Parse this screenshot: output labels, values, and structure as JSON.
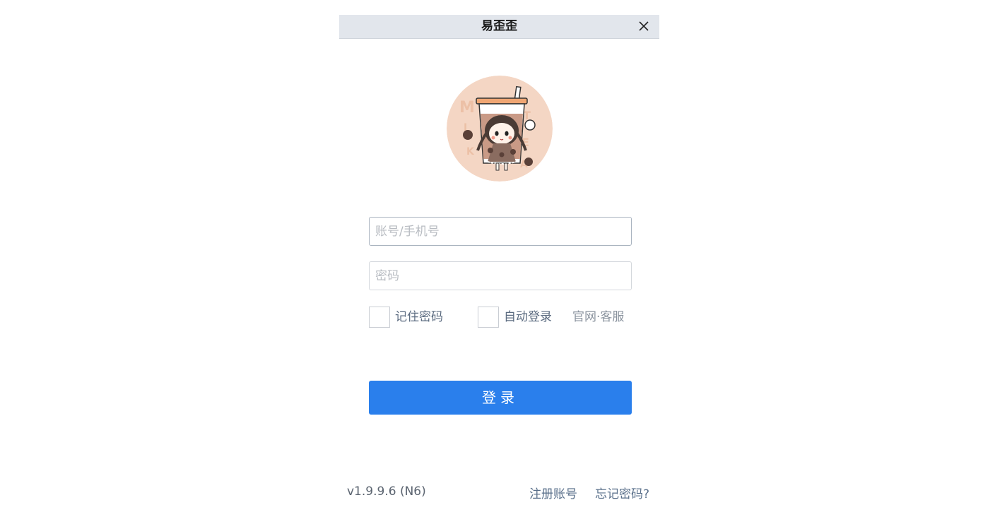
{
  "window": {
    "title": "易歪歪"
  },
  "avatar": {
    "name": "milk-tea-girl-avatar",
    "lettering": "MILK TEA",
    "background_color": "#f4d6c4"
  },
  "login_form": {
    "account_placeholder": "账号/手机号",
    "account_value": "",
    "password_placeholder": "密码",
    "password_value": "",
    "remember_password_label": "记住密码",
    "remember_password_checked": false,
    "auto_login_label": "自动登录",
    "auto_login_checked": false,
    "official_support_link": "官网·客服",
    "login_button_label": "登录"
  },
  "footer": {
    "version": "v1.9.9.6 (N6)",
    "register_link": "注册账号",
    "forgot_password_link": "忘记密码?"
  },
  "colors": {
    "titlebar_bg": "#e2e6ec",
    "primary_button": "#2a7fec",
    "link_text": "#5a708b"
  }
}
